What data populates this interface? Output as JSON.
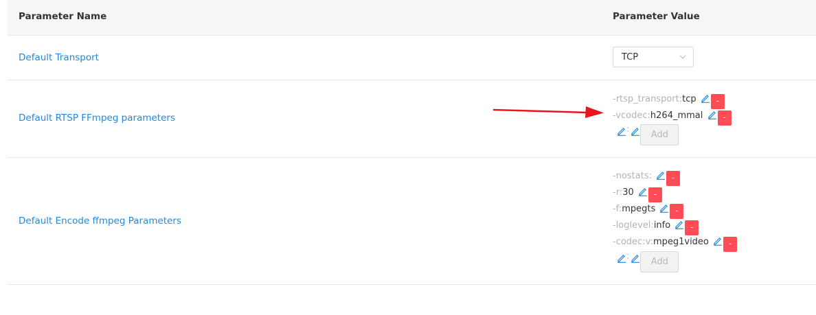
{
  "header": {
    "name_label": "Parameter Name",
    "value_label": "Parameter Value"
  },
  "rows": [
    {
      "name": "Default Transport",
      "select_value": "TCP"
    },
    {
      "name": "Default RTSP FFmpeg parameters",
      "params": [
        {
          "key": "-rtsp_transport:",
          "value": "tcp"
        },
        {
          "key": "-vcodec:",
          "value": "h264_mmal"
        }
      ],
      "colon": ":",
      "add_label": "Add",
      "delete_label": "-"
    },
    {
      "name": "Default Encode ffmpeg Parameters",
      "params": [
        {
          "key": "-nostats:",
          "value": ""
        },
        {
          "key": "-r:",
          "value": "30"
        },
        {
          "key": "-f:",
          "value": "mpegts"
        },
        {
          "key": "-loglevel:",
          "value": "info"
        },
        {
          "key": "-codec:v:",
          "value": "mpeg1video"
        }
      ],
      "colon": ":",
      "add_label": "Add",
      "delete_label": "-"
    }
  ],
  "colors": {
    "link": "#1e88e5",
    "delete": "#ff4d55",
    "arrow": "#e8161c"
  },
  "icons": {
    "edit": "pencil-icon",
    "dropdown": "chevron-down-icon",
    "annotation": "red-arrow"
  }
}
